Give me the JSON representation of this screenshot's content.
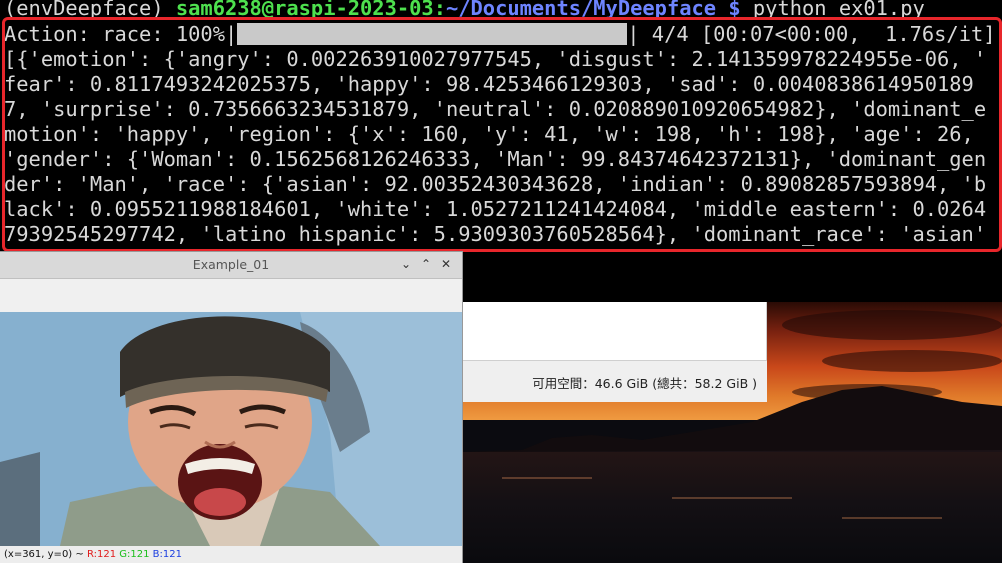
{
  "terminal": {
    "prompt": {
      "env": "(envDeepface)",
      "user_host": "sam6238@raspi-2023-03",
      "colon": ":",
      "path": "~/Documents/MyDeepface",
      "dollar": "$",
      "command": "python ex01.py"
    },
    "progress": {
      "prefix": "Action: race: 100%|",
      "percent": 100,
      "suffix": "| 4/4 [00:07<00:00,  1.76s/it]"
    },
    "output_lines": [
      "[{'emotion': {'angry': 0.002263910027977545, 'disgust': 2.141359978224955e-06, '",
      "fear': 0.8117493242025375, 'happy': 98.4253466129303, 'sad': 0.0040838614950189",
      "7, 'surprise': 0.7356663234531879, 'neutral': 0.020889010920654982}, 'dominant_e",
      "motion': 'happy', 'region': {'x': 160, 'y': 41, 'w': 198, 'h': 198}, 'age': 26,",
      "'gender': {'Woman': 0.1562568126246333, 'Man': 99.84374642372131}, 'dominant_gen",
      "der': 'Man', 'race': {'asian': 92.00352430343628, 'indian': 0.89082857593894, 'b",
      "lack': 0.0955211988184601, 'white': 1.0527211241424084, 'middle eastern': 0.0264",
      "79392545297742, 'latino hispanic': 5.9309303760528564}, 'dominant_race': 'asian'"
    ]
  },
  "file_manager": {
    "free_space_label": "可用空間：46.6 GiB (總共：58.2 GiB )"
  },
  "opencv_window": {
    "title": "Example_01",
    "controls": {
      "minimize": "⌄",
      "maximize": "⌃",
      "close": "✕"
    },
    "status": {
      "coords": "(x=361, y=0) ~",
      "r": "R:121",
      "g": "G:121",
      "b": "B:121"
    }
  },
  "colors": {
    "highlight": "#e8262b",
    "prompt_user": "#4ee04e",
    "prompt_path": "#6e84ff"
  }
}
